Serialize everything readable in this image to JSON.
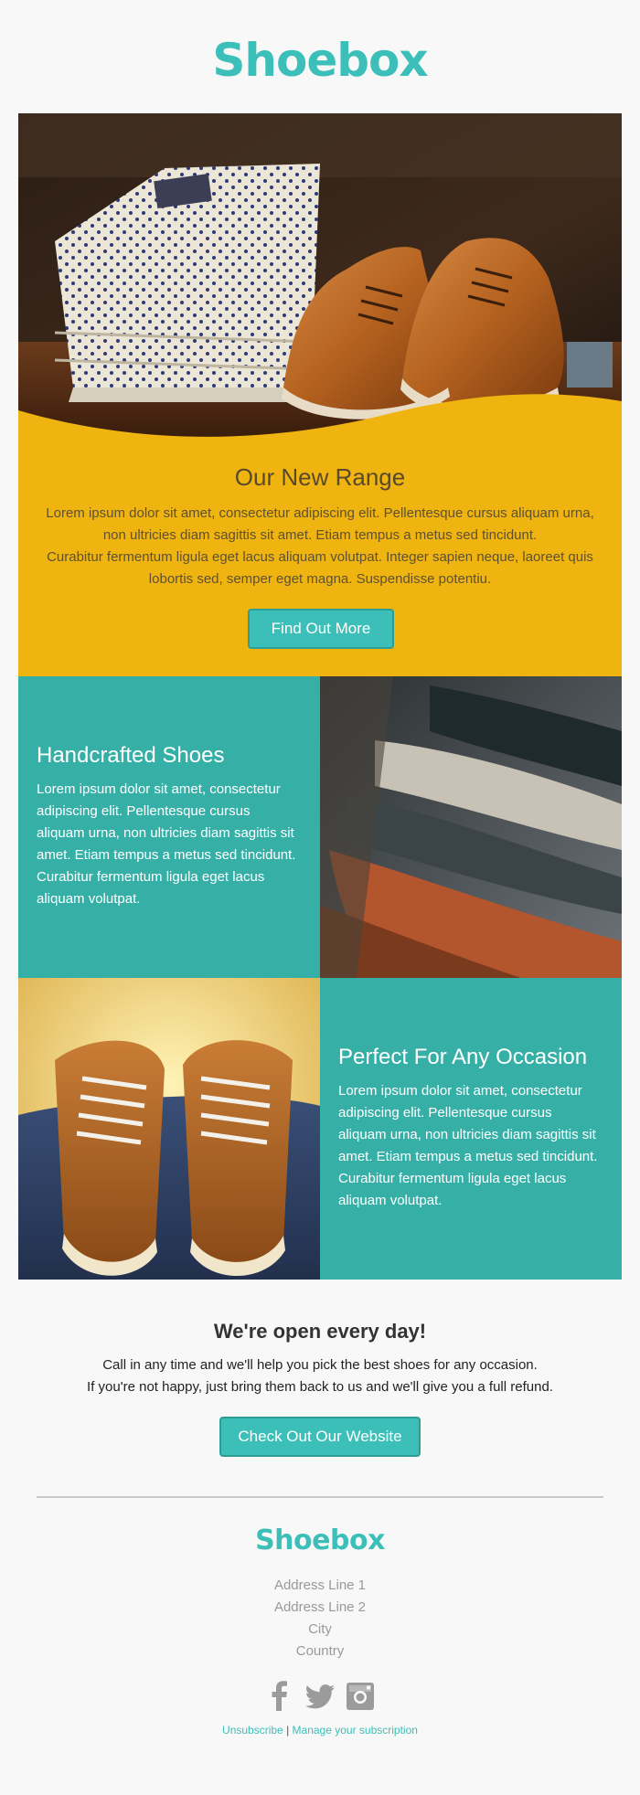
{
  "brand": {
    "name": "Shoebox",
    "color": "#3cbfb8"
  },
  "hero": {
    "title": "Our New Range",
    "body_line1": "Lorem ipsum dolor sit amet, consectetur adipiscing elit. Pellentesque cursus aliquam urna, non ultricies diam sagittis sit amet. Etiam tempus a metus sed tincidunt.",
    "body_line2": "Curabitur fermentum ligula eget lacus aliquam volutpat. Integer sapien neque, laoreet quis lobortis sed, semper eget magna. Suspendisse potentiu.",
    "button_label": "Find Out More",
    "background": "#f0b411"
  },
  "features": [
    {
      "title": "Handcrafted Shoes",
      "body": "Lorem ipsum dolor sit amet, consectetur adipiscing elit. Pellentesque cursus aliquam urna, non ultricies diam sagittis sit amet. Etiam tempus a metus sed tincidunt. Curabitur fermentum ligula eget lacus aliquam volutpat."
    },
    {
      "title": "Perfect For Any Occasion",
      "body": "Lorem ipsum dolor sit amet, consectetur adipiscing elit. Pellentesque cursus aliquam urna, non ultricies diam sagittis sit amet. Etiam tempus a metus sed tincidunt. Curabitur fermentum ligula eget lacus aliquam volutpat."
    }
  ],
  "open": {
    "title": "We're open every day!",
    "line1": "Call in any time and we'll help you pick the best shoes for any occasion.",
    "line2": "If you're not happy, just bring them back to us and we'll give you a full refund.",
    "button_label": "Check Out Our Website"
  },
  "footer": {
    "logo": "Shoebox",
    "address": [
      "Address Line 1",
      "Address Line 2",
      "City",
      "Country"
    ],
    "social_icons": [
      "facebook-icon",
      "twitter-icon",
      "instagram-icon"
    ],
    "unsubscribe_label": "Unsubscribe",
    "separator": " | ",
    "manage_label": "Manage your subscription"
  },
  "accent_color": "#36b0a7"
}
